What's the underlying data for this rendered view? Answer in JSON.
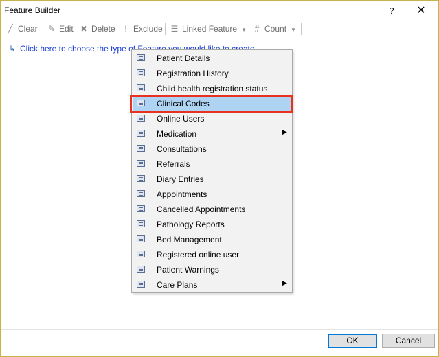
{
  "window": {
    "title": "Feature Builder",
    "help_label": "?",
    "close_label": "✕"
  },
  "toolbar": {
    "clear_label": "Clear",
    "edit_label": "Edit",
    "delete_label": "Delete",
    "exclude_label": "Exclude",
    "linked_feature_label": "Linked Feature",
    "count_label": "Count",
    "icons": {
      "clear": "eraser-icon",
      "edit": "pencil-icon",
      "delete": "delete-icon",
      "exclude": "exclamation-icon",
      "linked": "list-icon",
      "count": "hash-icon"
    }
  },
  "hint": {
    "text": "Click here to choose the type of Feature you would like to create"
  },
  "menu": {
    "items": [
      {
        "label": "Patient Details",
        "submenu": false
      },
      {
        "label": "Registration History",
        "submenu": false
      },
      {
        "label": "Child health registration status",
        "submenu": false
      },
      {
        "label": "Clinical Codes",
        "submenu": false,
        "highlighted": true
      },
      {
        "label": "Online Users",
        "submenu": false
      },
      {
        "label": "Medication",
        "submenu": true
      },
      {
        "label": "Consultations",
        "submenu": false
      },
      {
        "label": "Referrals",
        "submenu": false
      },
      {
        "label": "Diary Entries",
        "submenu": false
      },
      {
        "label": "Appointments",
        "submenu": false
      },
      {
        "label": "Cancelled Appointments",
        "submenu": false
      },
      {
        "label": "Pathology Reports",
        "submenu": false
      },
      {
        "label": "Bed Management",
        "submenu": false
      },
      {
        "label": "Registered online user",
        "submenu": false
      },
      {
        "label": "Patient Warnings",
        "submenu": false
      },
      {
        "label": "Care Plans",
        "submenu": true
      }
    ],
    "highlight_color": "#aed3f3",
    "annotation_color": "#e8321f"
  },
  "footer": {
    "ok_label": "OK",
    "cancel_label": "Cancel"
  }
}
